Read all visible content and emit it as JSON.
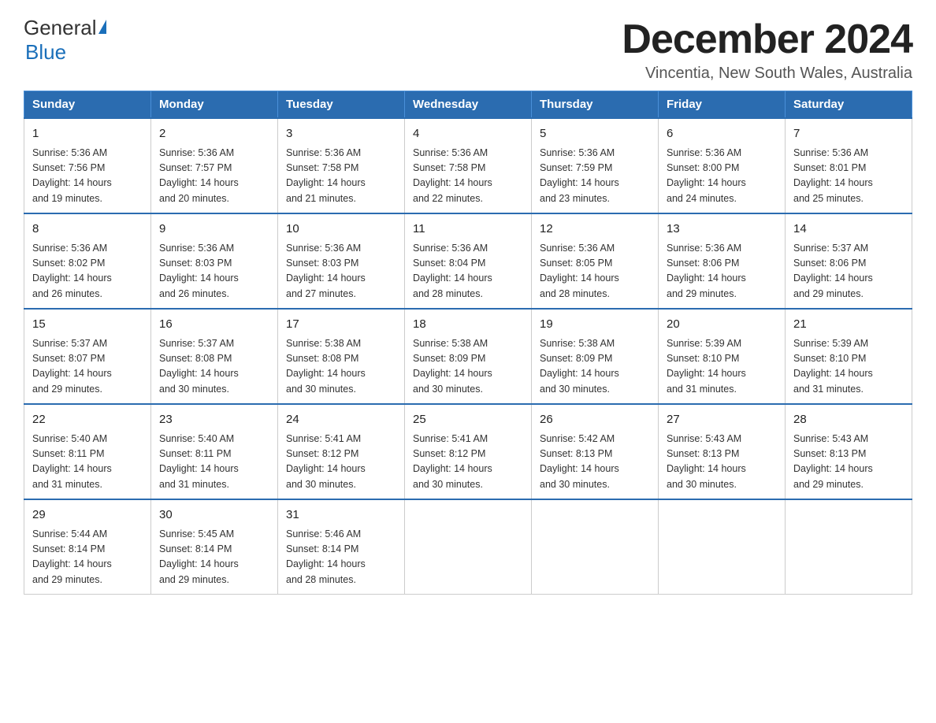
{
  "logo": {
    "general": "General",
    "blue": "Blue"
  },
  "title": "December 2024",
  "subtitle": "Vincentia, New South Wales, Australia",
  "headers": [
    "Sunday",
    "Monday",
    "Tuesday",
    "Wednesday",
    "Thursday",
    "Friday",
    "Saturday"
  ],
  "weeks": [
    [
      {
        "day": "1",
        "sunrise": "Sunrise: 5:36 AM",
        "sunset": "Sunset: 7:56 PM",
        "daylight": "Daylight: 14 hours",
        "daylight2": "and 19 minutes."
      },
      {
        "day": "2",
        "sunrise": "Sunrise: 5:36 AM",
        "sunset": "Sunset: 7:57 PM",
        "daylight": "Daylight: 14 hours",
        "daylight2": "and 20 minutes."
      },
      {
        "day": "3",
        "sunrise": "Sunrise: 5:36 AM",
        "sunset": "Sunset: 7:58 PM",
        "daylight": "Daylight: 14 hours",
        "daylight2": "and 21 minutes."
      },
      {
        "day": "4",
        "sunrise": "Sunrise: 5:36 AM",
        "sunset": "Sunset: 7:58 PM",
        "daylight": "Daylight: 14 hours",
        "daylight2": "and 22 minutes."
      },
      {
        "day": "5",
        "sunrise": "Sunrise: 5:36 AM",
        "sunset": "Sunset: 7:59 PM",
        "daylight": "Daylight: 14 hours",
        "daylight2": "and 23 minutes."
      },
      {
        "day": "6",
        "sunrise": "Sunrise: 5:36 AM",
        "sunset": "Sunset: 8:00 PM",
        "daylight": "Daylight: 14 hours",
        "daylight2": "and 24 minutes."
      },
      {
        "day": "7",
        "sunrise": "Sunrise: 5:36 AM",
        "sunset": "Sunset: 8:01 PM",
        "daylight": "Daylight: 14 hours",
        "daylight2": "and 25 minutes."
      }
    ],
    [
      {
        "day": "8",
        "sunrise": "Sunrise: 5:36 AM",
        "sunset": "Sunset: 8:02 PM",
        "daylight": "Daylight: 14 hours",
        "daylight2": "and 26 minutes."
      },
      {
        "day": "9",
        "sunrise": "Sunrise: 5:36 AM",
        "sunset": "Sunset: 8:03 PM",
        "daylight": "Daylight: 14 hours",
        "daylight2": "and 26 minutes."
      },
      {
        "day": "10",
        "sunrise": "Sunrise: 5:36 AM",
        "sunset": "Sunset: 8:03 PM",
        "daylight": "Daylight: 14 hours",
        "daylight2": "and 27 minutes."
      },
      {
        "day": "11",
        "sunrise": "Sunrise: 5:36 AM",
        "sunset": "Sunset: 8:04 PM",
        "daylight": "Daylight: 14 hours",
        "daylight2": "and 28 minutes."
      },
      {
        "day": "12",
        "sunrise": "Sunrise: 5:36 AM",
        "sunset": "Sunset: 8:05 PM",
        "daylight": "Daylight: 14 hours",
        "daylight2": "and 28 minutes."
      },
      {
        "day": "13",
        "sunrise": "Sunrise: 5:36 AM",
        "sunset": "Sunset: 8:06 PM",
        "daylight": "Daylight: 14 hours",
        "daylight2": "and 29 minutes."
      },
      {
        "day": "14",
        "sunrise": "Sunrise: 5:37 AM",
        "sunset": "Sunset: 8:06 PM",
        "daylight": "Daylight: 14 hours",
        "daylight2": "and 29 minutes."
      }
    ],
    [
      {
        "day": "15",
        "sunrise": "Sunrise: 5:37 AM",
        "sunset": "Sunset: 8:07 PM",
        "daylight": "Daylight: 14 hours",
        "daylight2": "and 29 minutes."
      },
      {
        "day": "16",
        "sunrise": "Sunrise: 5:37 AM",
        "sunset": "Sunset: 8:08 PM",
        "daylight": "Daylight: 14 hours",
        "daylight2": "and 30 minutes."
      },
      {
        "day": "17",
        "sunrise": "Sunrise: 5:38 AM",
        "sunset": "Sunset: 8:08 PM",
        "daylight": "Daylight: 14 hours",
        "daylight2": "and 30 minutes."
      },
      {
        "day": "18",
        "sunrise": "Sunrise: 5:38 AM",
        "sunset": "Sunset: 8:09 PM",
        "daylight": "Daylight: 14 hours",
        "daylight2": "and 30 minutes."
      },
      {
        "day": "19",
        "sunrise": "Sunrise: 5:38 AM",
        "sunset": "Sunset: 8:09 PM",
        "daylight": "Daylight: 14 hours",
        "daylight2": "and 30 minutes."
      },
      {
        "day": "20",
        "sunrise": "Sunrise: 5:39 AM",
        "sunset": "Sunset: 8:10 PM",
        "daylight": "Daylight: 14 hours",
        "daylight2": "and 31 minutes."
      },
      {
        "day": "21",
        "sunrise": "Sunrise: 5:39 AM",
        "sunset": "Sunset: 8:10 PM",
        "daylight": "Daylight: 14 hours",
        "daylight2": "and 31 minutes."
      }
    ],
    [
      {
        "day": "22",
        "sunrise": "Sunrise: 5:40 AM",
        "sunset": "Sunset: 8:11 PM",
        "daylight": "Daylight: 14 hours",
        "daylight2": "and 31 minutes."
      },
      {
        "day": "23",
        "sunrise": "Sunrise: 5:40 AM",
        "sunset": "Sunset: 8:11 PM",
        "daylight": "Daylight: 14 hours",
        "daylight2": "and 31 minutes."
      },
      {
        "day": "24",
        "sunrise": "Sunrise: 5:41 AM",
        "sunset": "Sunset: 8:12 PM",
        "daylight": "Daylight: 14 hours",
        "daylight2": "and 30 minutes."
      },
      {
        "day": "25",
        "sunrise": "Sunrise: 5:41 AM",
        "sunset": "Sunset: 8:12 PM",
        "daylight": "Daylight: 14 hours",
        "daylight2": "and 30 minutes."
      },
      {
        "day": "26",
        "sunrise": "Sunrise: 5:42 AM",
        "sunset": "Sunset: 8:13 PM",
        "daylight": "Daylight: 14 hours",
        "daylight2": "and 30 minutes."
      },
      {
        "day": "27",
        "sunrise": "Sunrise: 5:43 AM",
        "sunset": "Sunset: 8:13 PM",
        "daylight": "Daylight: 14 hours",
        "daylight2": "and 30 minutes."
      },
      {
        "day": "28",
        "sunrise": "Sunrise: 5:43 AM",
        "sunset": "Sunset: 8:13 PM",
        "daylight": "Daylight: 14 hours",
        "daylight2": "and 29 minutes."
      }
    ],
    [
      {
        "day": "29",
        "sunrise": "Sunrise: 5:44 AM",
        "sunset": "Sunset: 8:14 PM",
        "daylight": "Daylight: 14 hours",
        "daylight2": "and 29 minutes."
      },
      {
        "day": "30",
        "sunrise": "Sunrise: 5:45 AM",
        "sunset": "Sunset: 8:14 PM",
        "daylight": "Daylight: 14 hours",
        "daylight2": "and 29 minutes."
      },
      {
        "day": "31",
        "sunrise": "Sunrise: 5:46 AM",
        "sunset": "Sunset: 8:14 PM",
        "daylight": "Daylight: 14 hours",
        "daylight2": "and 28 minutes."
      },
      null,
      null,
      null,
      null
    ]
  ]
}
